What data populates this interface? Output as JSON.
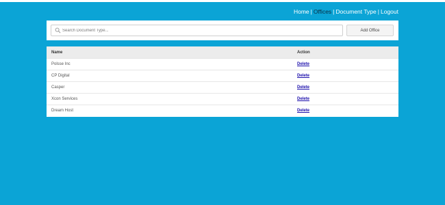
{
  "nav": {
    "home": "Home",
    "offices": "Offices",
    "document_type": "Document Type",
    "logout": "Logout",
    "separator": "|"
  },
  "search": {
    "placeholder": "Search Document Type..."
  },
  "toolbar": {
    "add_label": "Add Office"
  },
  "table": {
    "columns": [
      "Name",
      "Action"
    ],
    "rows": [
      {
        "name": "Polsse Inc",
        "action": "Delete"
      },
      {
        "name": "CP Digital",
        "action": "Delete"
      },
      {
        "name": "Casper",
        "action": "Delete"
      },
      {
        "name": "Xcon Services",
        "action": "Delete"
      },
      {
        "name": "Dream Host",
        "action": "Delete"
      }
    ]
  },
  "colors": {
    "background": "#0ba4d6",
    "active_nav": "#0a2f44",
    "link": "#1a0dab"
  }
}
